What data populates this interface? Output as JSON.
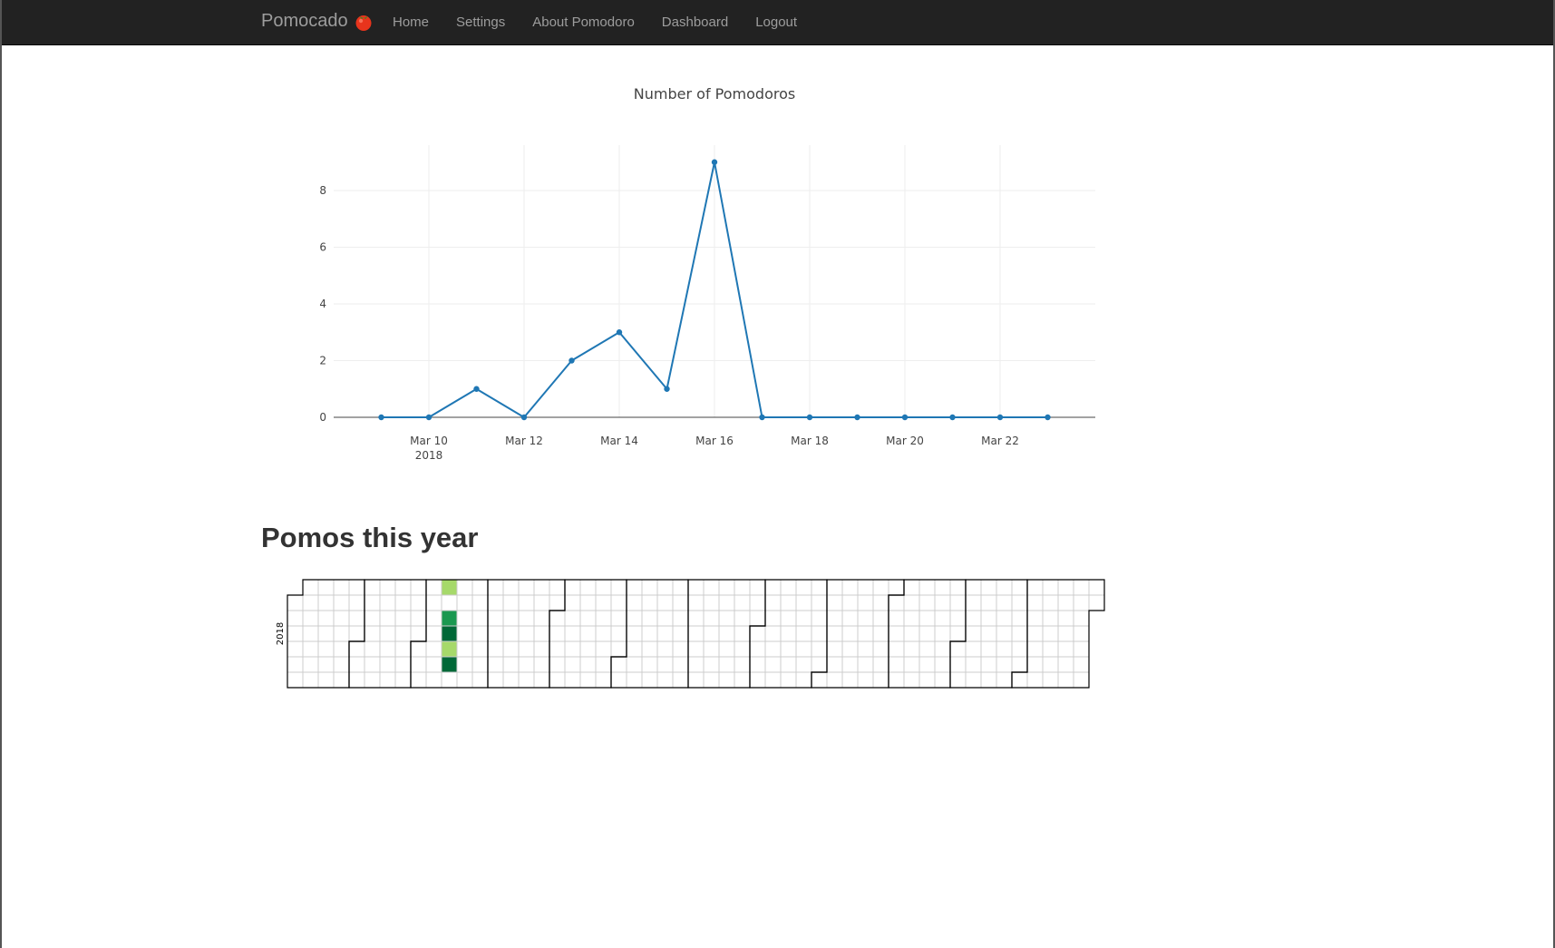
{
  "navbar": {
    "brand_label": "Pomocado",
    "brand_icon": "tomato-icon",
    "items": [
      {
        "label": "Home"
      },
      {
        "label": "Settings"
      },
      {
        "label": "About Pomodoro"
      },
      {
        "label": "Dashboard"
      },
      {
        "label": "Logout"
      }
    ]
  },
  "chart_data": {
    "type": "line",
    "title": "Number of Pomodoros",
    "xlabel": "",
    "ylabel": "",
    "x": [
      "2018-03-09",
      "2018-03-10",
      "2018-03-11",
      "2018-03-12",
      "2018-03-13",
      "2018-03-14",
      "2018-03-15",
      "2018-03-16",
      "2018-03-17",
      "2018-03-18",
      "2018-03-19",
      "2018-03-20",
      "2018-03-21",
      "2018-03-22",
      "2018-03-23"
    ],
    "series": [
      {
        "values": [
          0,
          0,
          1,
          0,
          2,
          3,
          1,
          9,
          0,
          0,
          0,
          0,
          0,
          0,
          0
        ]
      }
    ],
    "x_ticks": [
      {
        "date": "2018-03-10",
        "label": "Mar 10",
        "sublabel": "2018"
      },
      {
        "date": "2018-03-12",
        "label": "Mar 12"
      },
      {
        "date": "2018-03-14",
        "label": "Mar 14"
      },
      {
        "date": "2018-03-16",
        "label": "Mar 16"
      },
      {
        "date": "2018-03-18",
        "label": "Mar 18"
      },
      {
        "date": "2018-03-20",
        "label": "Mar 20"
      },
      {
        "date": "2018-03-22",
        "label": "Mar 22"
      }
    ],
    "y_ticks": [
      0,
      2,
      4,
      6,
      8
    ],
    "xlim": [
      "2018-03-08",
      "2018-03-24"
    ],
    "ylim": [
      0,
      9.6
    ],
    "grid": true,
    "line_color": "#1f77b4"
  },
  "heatmap": {
    "title": "Pomos this year",
    "year_label": "2018",
    "start_date": "2018-01-01",
    "days": 365,
    "filled_days": [
      {
        "date": "2018-03-11",
        "color": "#a6d96a"
      },
      {
        "date": "2018-03-13",
        "color": "#1a9850"
      },
      {
        "date": "2018-03-14",
        "color": "#006837"
      },
      {
        "date": "2018-03-15",
        "color": "#a6d96a"
      },
      {
        "date": "2018-03-16",
        "color": "#006837"
      }
    ]
  }
}
